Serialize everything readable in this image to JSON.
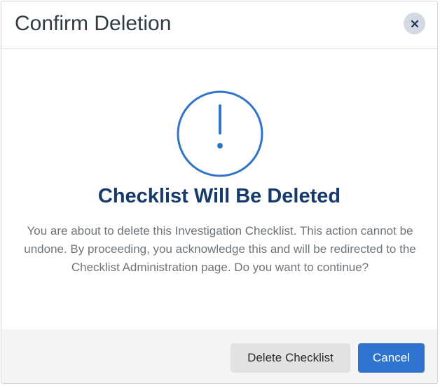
{
  "dialog": {
    "title": "Confirm Deletion",
    "close_icon": "close-icon",
    "warning_icon": "exclamation-circle-icon",
    "heading": "Checklist Will Be Deleted",
    "message": "You are about to delete this Investigation Checklist. This action cannot be undone. By proceeding, you acknowledge this and will be redirected to the Checklist Administration page. Do you want to continue?",
    "buttons": {
      "delete_label": "Delete Checklist",
      "cancel_label": "Cancel"
    }
  },
  "colors": {
    "accent": "#2f73cf",
    "heading": "#153a6b",
    "icon": "#3173c8",
    "close_bg": "#d4d9e2"
  }
}
